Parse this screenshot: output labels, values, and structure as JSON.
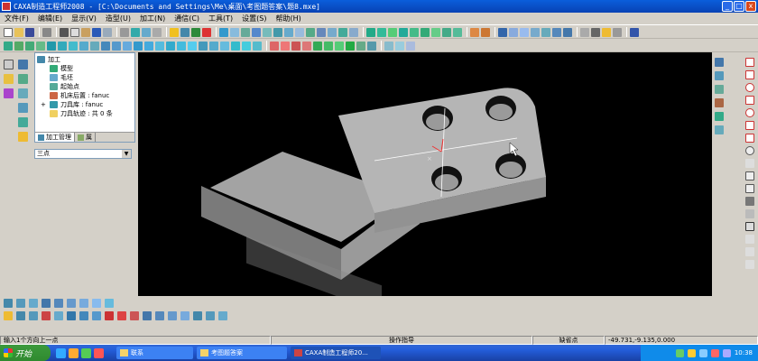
{
  "window": {
    "title": "CAXA制造工程师2008 - [C:\\Documents and Settings\\Me\\桌面\\考图题答案\\题8.mxe]",
    "controls": [
      "_",
      "□",
      "x"
    ]
  },
  "menu": [
    "文件(F)",
    "编辑(E)",
    "显示(V)",
    "造型(U)",
    "加工(N)",
    "通信(C)",
    "工具(T)",
    "设置(S)",
    "帮助(H)"
  ],
  "tree": {
    "root": "加工",
    "items": [
      {
        "label": "模型"
      },
      {
        "label": "毛坯"
      },
      {
        "label": "起始点"
      },
      {
        "label": "机床后置 : fanuc"
      },
      {
        "label": "刀具库 : fanuc"
      },
      {
        "label": "刀具轨迹 : 共 0 条"
      }
    ],
    "tabs": [
      "加工管理",
      "属"
    ]
  },
  "combo": {
    "value": "三点"
  },
  "status": {
    "prompt": "输入1个方向上一点",
    "op": "操作指导",
    "mode": "缺省点",
    "coords": "-49.731,-9.135,0.000"
  },
  "taskbar": {
    "start": "开始",
    "tasks": [
      "联系",
      "考图题答案",
      "CAXA制造工程师20..."
    ],
    "clock": "10:38"
  },
  "colors": {
    "titlebar": "#0a5edb",
    "viewport_bg": "#000000",
    "part_top": "#b5b5b5",
    "part_side": "#8a8a8a"
  }
}
